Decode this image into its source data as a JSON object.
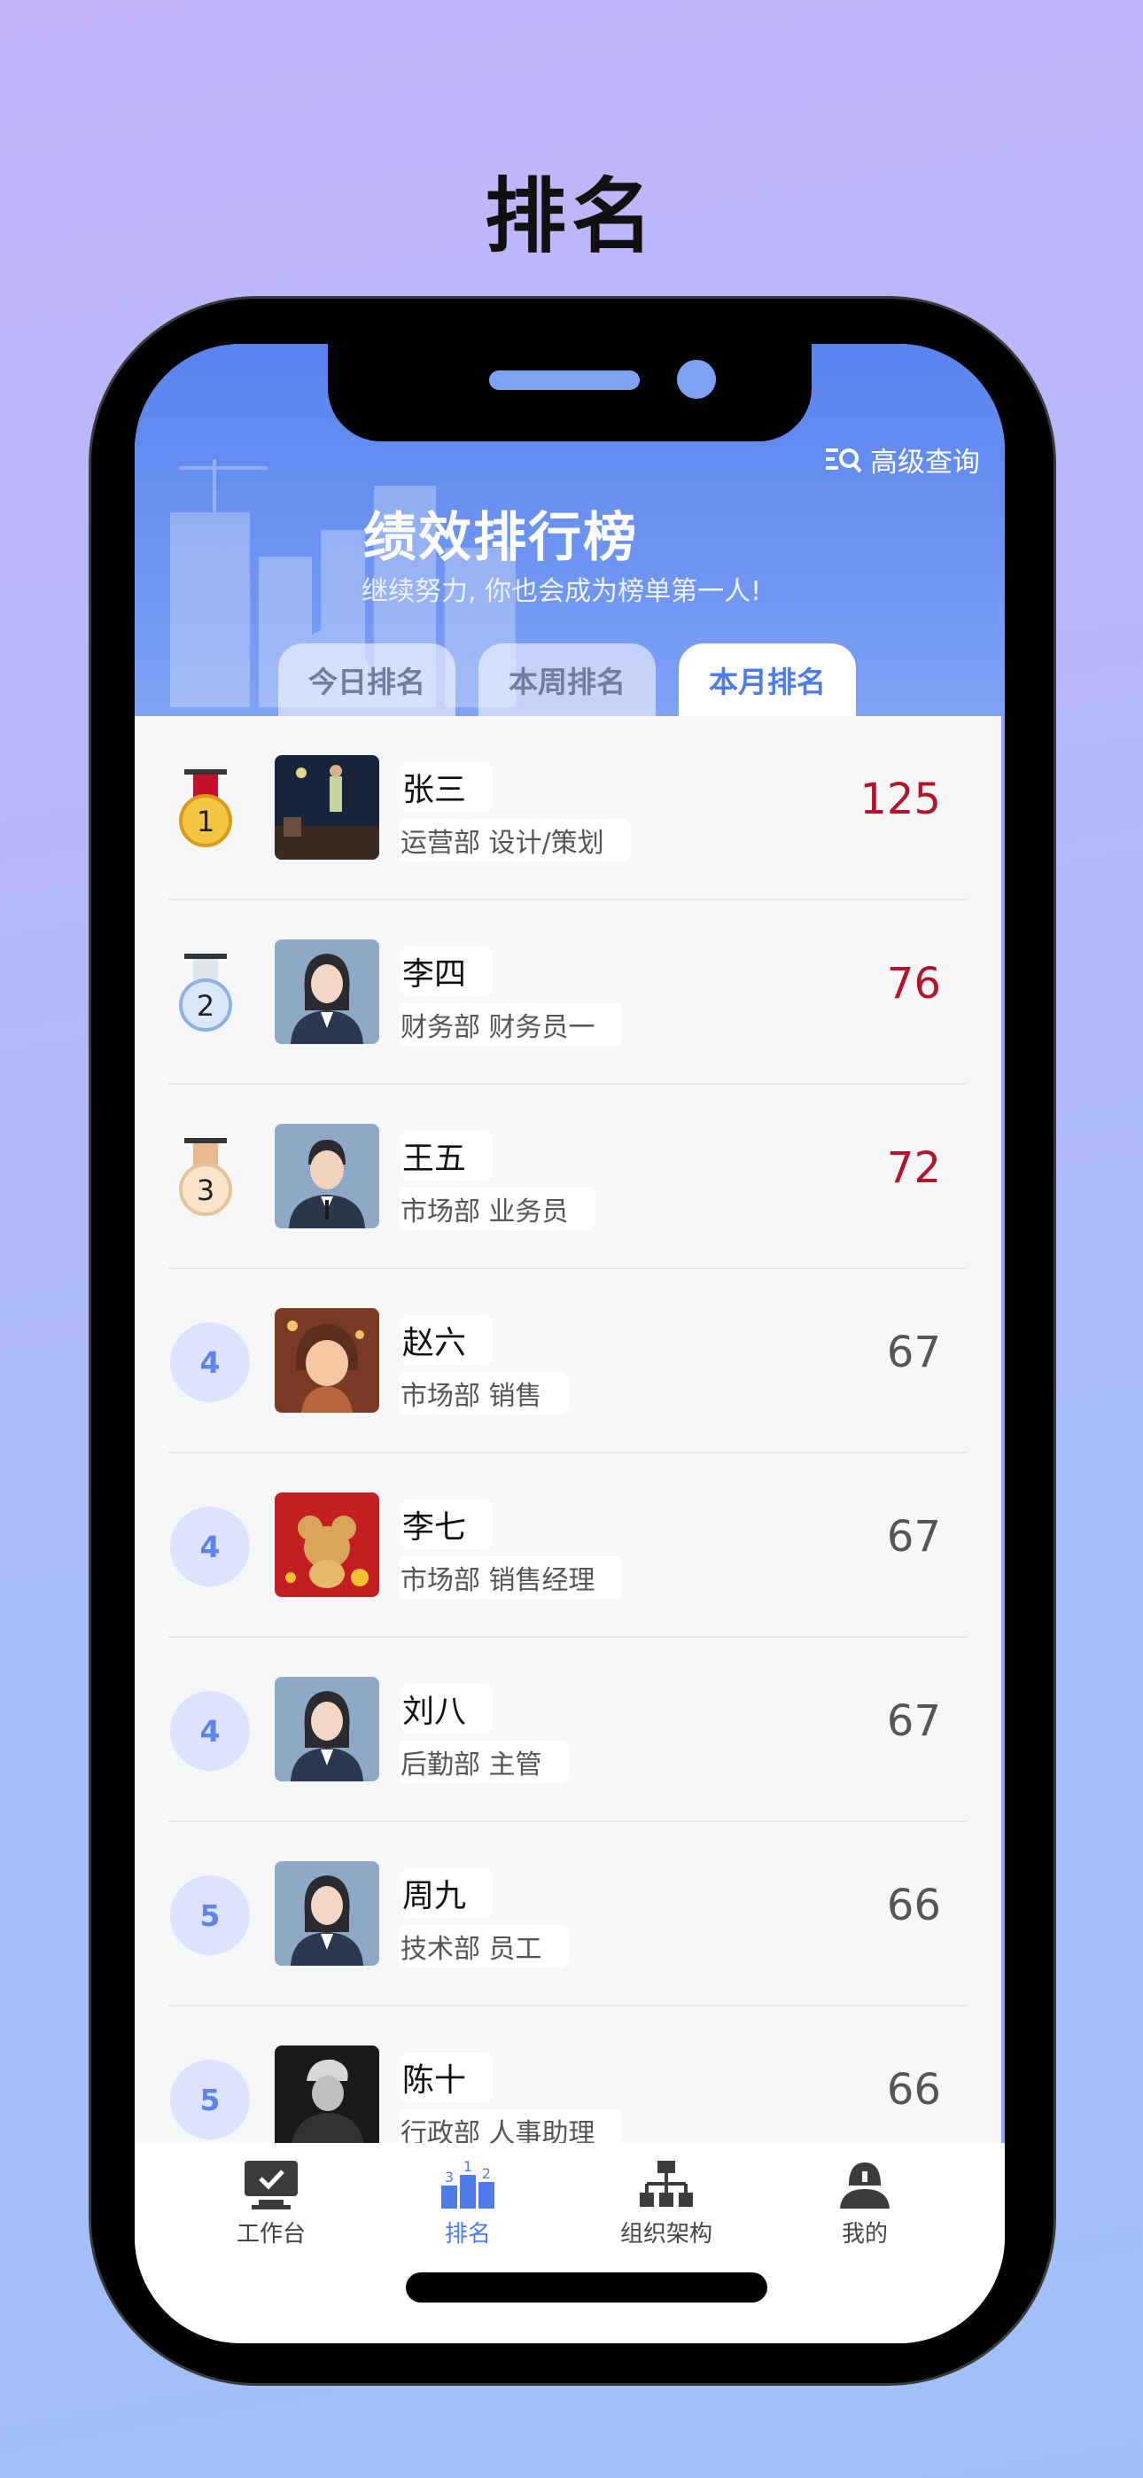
{
  "page_heading": "排名",
  "header": {
    "query_label": "高级查询",
    "title": "绩效排行榜",
    "subtitle": "继续努力, 你也会成为榜单第一人!"
  },
  "tabs": [
    {
      "label": "今日排名",
      "active": false
    },
    {
      "label": "本周排名",
      "active": false
    },
    {
      "label": "本月排名",
      "active": true
    }
  ],
  "ranking": [
    {
      "rank": "1",
      "medal": "gold",
      "name": "张三",
      "dept": "运营部 设计/策划",
      "score": "125",
      "avatar": "night-photo"
    },
    {
      "rank": "2",
      "medal": "silver",
      "name": "李四",
      "dept": "财务部 财务员一",
      "score": "76",
      "avatar": "female-suit"
    },
    {
      "rank": "3",
      "medal": "bronze",
      "name": "王五",
      "dept": "市场部 业务员",
      "score": "72",
      "avatar": "male-suit"
    },
    {
      "rank": "4",
      "medal": "",
      "name": "赵六",
      "dept": "市场部 销售",
      "score": "67",
      "avatar": "girl-illustration"
    },
    {
      "rank": "4",
      "medal": "",
      "name": "李七",
      "dept": "市场部 销售经理",
      "score": "67",
      "avatar": "cartoon-mouse"
    },
    {
      "rank": "4",
      "medal": "",
      "name": "刘八",
      "dept": "后勤部 主管",
      "score": "67",
      "avatar": "female-suit"
    },
    {
      "rank": "5",
      "medal": "",
      "name": "周九",
      "dept": "技术部 员工",
      "score": "66",
      "avatar": "female-suit"
    },
    {
      "rank": "5",
      "medal": "",
      "name": "陈十",
      "dept": "行政部 人事助理",
      "score": "66",
      "avatar": "dark-portrait"
    }
  ],
  "bottom_nav": [
    {
      "label": "工作台",
      "icon": "desktop-check-icon",
      "active": false
    },
    {
      "label": "排名",
      "icon": "podium-icon",
      "active": true
    },
    {
      "label": "组织架构",
      "icon": "org-chart-icon",
      "active": false
    },
    {
      "label": "我的",
      "icon": "user-icon",
      "active": false
    }
  ],
  "colors": {
    "accent": "#4f7be8",
    "top_score": "#b0152e",
    "header_blue": "#5a83ee"
  }
}
